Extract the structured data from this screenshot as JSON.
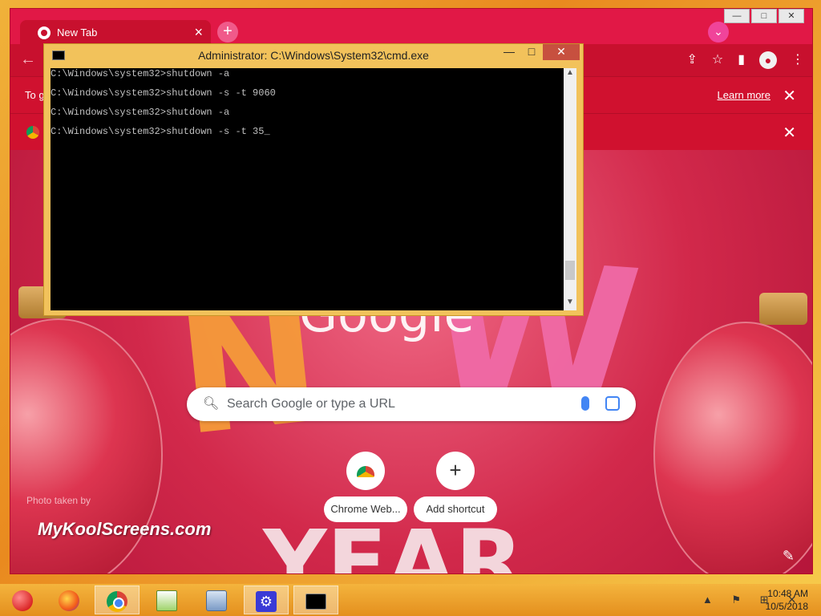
{
  "chrome": {
    "tab_title": "New Tab",
    "tab_close": "×",
    "new_tab": "+",
    "window_controls": [
      "—",
      "□",
      "✕"
    ],
    "profile_badge": "⌄",
    "back": "←",
    "toolbar_icons": [
      "⇪",
      "☆",
      "▮",
      "●",
      "⋮"
    ],
    "info1": {
      "text": "To g",
      "learn_more": "Learn more",
      "close": "✕"
    },
    "info2": {
      "close": "✕"
    }
  },
  "ntp": {
    "logo_text": "Google",
    "search_placeholder": "Search Google or type a URL",
    "shortcuts": [
      {
        "label": "Chrome Web...",
        "icon": "webstore-icon"
      },
      {
        "label": "Add shortcut",
        "icon": "plus-icon",
        "glyph": "+"
      }
    ],
    "photo_by": "Photo taken by",
    "watermark": "MyKoolScreens.com",
    "customize_glyph": "✎"
  },
  "cmd": {
    "title": "Administrator: C:\\Windows\\System32\\cmd.exe",
    "controls": [
      "—",
      "□",
      "✕"
    ],
    "lines": [
      "C:\\Windows\\system32>shutdown -a",
      "C:\\Windows\\system32>shutdown -s -t 9060",
      "C:\\Windows\\system32>shutdown -a",
      "C:\\Windows\\system32>shutdown -s -t 35_"
    ]
  },
  "taskbar": {
    "apps": [
      "start-orb",
      "firefox",
      "chrome",
      "notepad",
      "resource-monitor",
      "settings",
      "cmd"
    ],
    "settings_glyph": "⚙",
    "tray_icons": "▲ ⚑ ⊞ ✕",
    "time": "10:48 AM",
    "date": "10/5/2018"
  }
}
